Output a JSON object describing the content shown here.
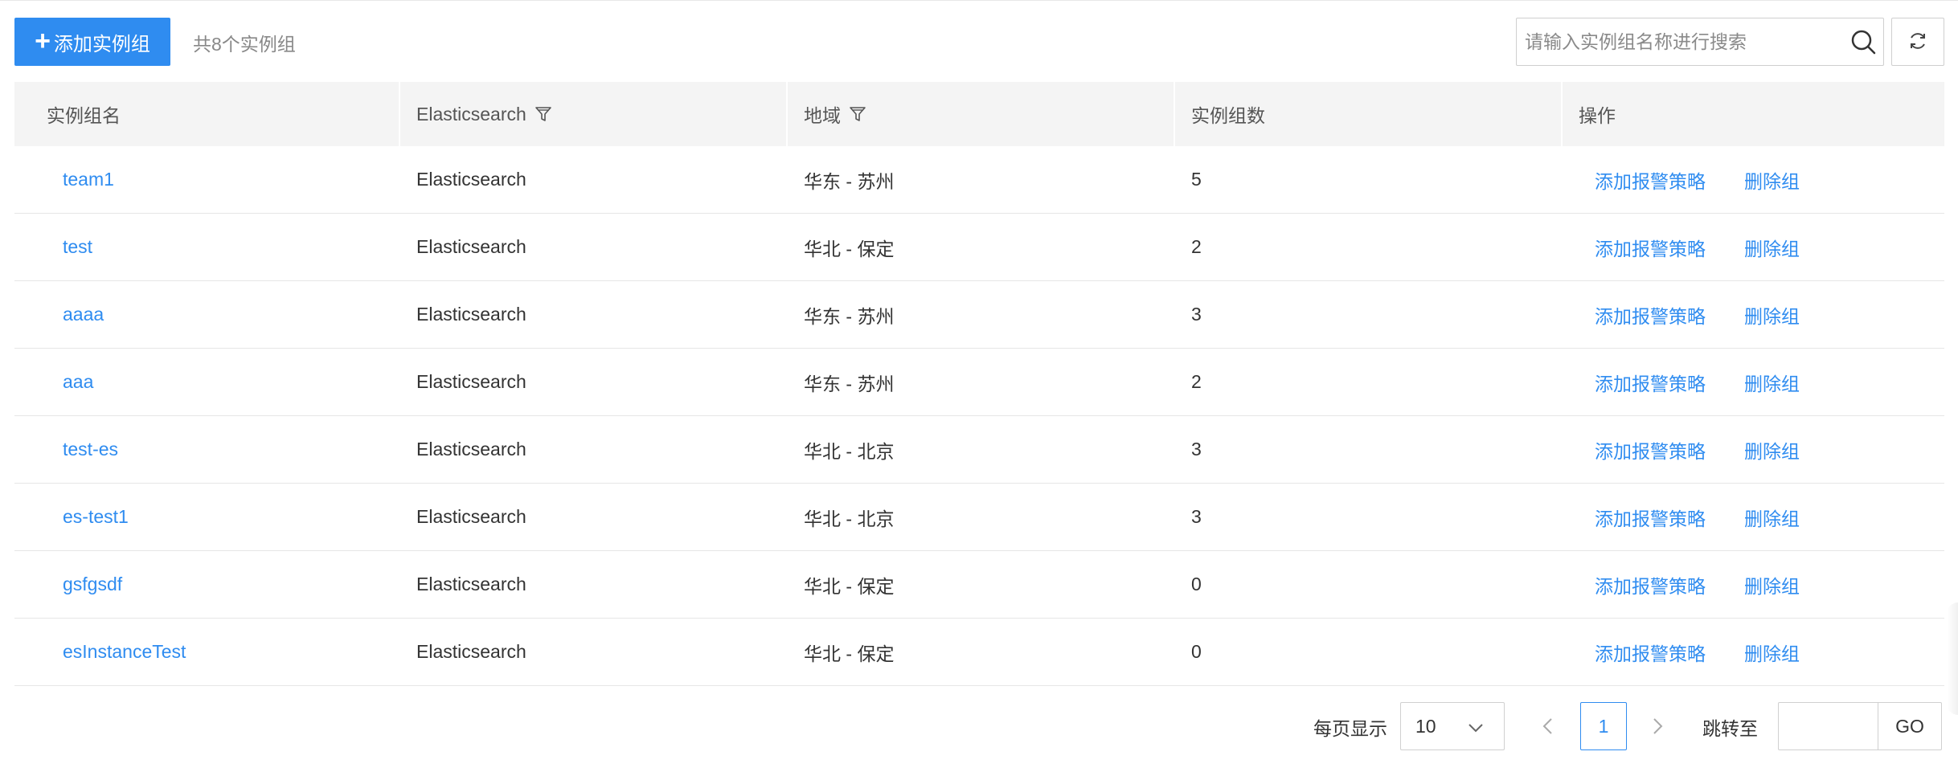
{
  "toolbar": {
    "add_label": "添加实例组",
    "count_text": "共8个实例组",
    "search_placeholder": "请输入实例组名称进行搜索",
    "search_icon": "search-icon",
    "refresh_icon": "refresh-icon"
  },
  "table": {
    "headers": [
      "实例组名",
      "Elasticsearch",
      "地域",
      "实例组数",
      "操作"
    ],
    "rows": [
      {
        "name": "team1",
        "product": "Elasticsearch",
        "region": "华东 - 苏州",
        "count": "5"
      },
      {
        "name": "test",
        "product": "Elasticsearch",
        "region": "华北 - 保定",
        "count": "2"
      },
      {
        "name": "aaaa",
        "product": "Elasticsearch",
        "region": "华东 - 苏州",
        "count": "3"
      },
      {
        "name": "aaa",
        "product": "Elasticsearch",
        "region": "华东 - 苏州",
        "count": "2"
      },
      {
        "name": "test-es",
        "product": "Elasticsearch",
        "region": "华北 - 北京",
        "count": "3"
      },
      {
        "name": "es-test1",
        "product": "Elasticsearch",
        "region": "华北 - 北京",
        "count": "3"
      },
      {
        "name": "gsfgsdf",
        "product": "Elasticsearch",
        "region": "华北 - 保定",
        "count": "0"
      },
      {
        "name": "esInstanceTest",
        "product": "Elasticsearch",
        "region": "华北 - 保定",
        "count": "0"
      }
    ],
    "actions": {
      "add_policy": "添加报警策略",
      "delete_group": "删除组"
    }
  },
  "pagination": {
    "page_size_label": "每页显示",
    "page_size": "10",
    "current_page": "1",
    "jump_label": "跳转至",
    "go_label": "GO"
  },
  "colors": {
    "accent": "#2f8cf0",
    "header_bg": "#f4f4f4"
  }
}
